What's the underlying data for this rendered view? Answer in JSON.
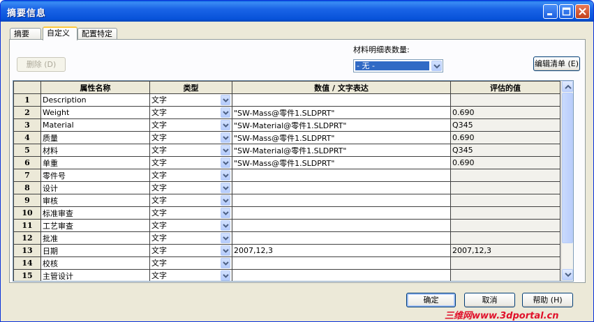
{
  "window": {
    "title": "摘要信息"
  },
  "tabs": [
    {
      "label": "摘要"
    },
    {
      "label": "自定义"
    },
    {
      "label": "配置特定"
    }
  ],
  "toolbar": {
    "delete_label": "删除 (D)",
    "qty_label": "材料明细表数量:",
    "qty_value": "- 无 -",
    "edit_list_label": "编辑清单 (E)"
  },
  "table": {
    "columns": [
      "属性名称",
      "类型",
      "数值 / 文字表达",
      "评估的值"
    ],
    "rows": [
      {
        "num": "1",
        "name": "Description",
        "type": "文字",
        "value": "",
        "evaluated": ""
      },
      {
        "num": "2",
        "name": "Weight",
        "type": "文字",
        "value": "\"SW-Mass@零件1.SLDPRT\"",
        "evaluated": "0.690"
      },
      {
        "num": "3",
        "name": "Material",
        "type": "文字",
        "value": "\"SW-Material@零件1.SLDPRT\"",
        "evaluated": "Q345"
      },
      {
        "num": "4",
        "name": "质量",
        "type": "文字",
        "value": "\"SW-Mass@零件1.SLDPRT\"",
        "evaluated": "0.690"
      },
      {
        "num": "5",
        "name": "材料",
        "type": "文字",
        "value": "\"SW-Material@零件1.SLDPRT\"",
        "evaluated": "Q345"
      },
      {
        "num": "6",
        "name": "单重",
        "type": "文字",
        "value": "\"SW-Mass@零件1.SLDPRT\"",
        "evaluated": "0.690"
      },
      {
        "num": "7",
        "name": "零件号",
        "type": "文字",
        "value": "",
        "evaluated": ""
      },
      {
        "num": "8",
        "name": "设计",
        "type": "文字",
        "value": "",
        "evaluated": ""
      },
      {
        "num": "9",
        "name": "审核",
        "type": "文字",
        "value": "",
        "evaluated": ""
      },
      {
        "num": "10",
        "name": "标准审查",
        "type": "文字",
        "value": "",
        "evaluated": ""
      },
      {
        "num": "11",
        "name": "工艺审查",
        "type": "文字",
        "value": "",
        "evaluated": ""
      },
      {
        "num": "12",
        "name": "批准",
        "type": "文字",
        "value": "",
        "evaluated": ""
      },
      {
        "num": "13",
        "name": "日期",
        "type": "文字",
        "value": "2007,12,3",
        "evaluated": "2007,12,3"
      },
      {
        "num": "14",
        "name": "校核",
        "type": "文字",
        "value": "",
        "evaluated": ""
      },
      {
        "num": "15",
        "name": "主管设计",
        "type": "文字",
        "value": "",
        "evaluated": ""
      }
    ]
  },
  "footer": {
    "ok_label": "确定",
    "cancel_label": "取消",
    "help_label": "帮助 (H)"
  },
  "watermark": "三维网www.3dportal.cn",
  "colors": {
    "titlebar": "#0752d9",
    "selection": "#316ac5",
    "active_tab_accent": "#ffc83c"
  },
  "icons": [
    "minimize-icon",
    "maximize-icon",
    "close-icon",
    "chevron-down-icon",
    "arrow-up-icon",
    "arrow-down-icon"
  ]
}
